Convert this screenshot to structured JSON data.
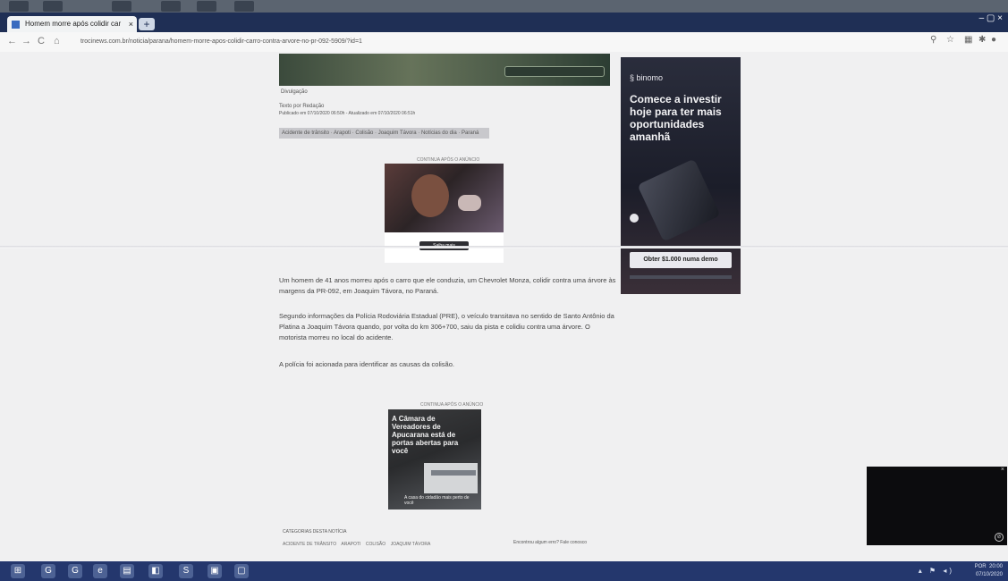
{
  "browser": {
    "tab_title": "Homem morre após colidir car",
    "tab_close": "×",
    "new_tab": "+",
    "window_controls": "– ▢ ×",
    "url": "trocinews.com.br/noticia/parana/homem-morre-apos-colidir-carro-contra-arvore-no-pr-092-5909/?id=1",
    "nav_back": "←",
    "nav_forward": "→",
    "nav_reload": "C",
    "nav_home": "⌂"
  },
  "article": {
    "hero_caption": "Divulgação",
    "byline_line1": "Texto por Redação",
    "byline_line2": "Publicado em 07/10/2020 06:50h - Atualizado em 07/10/2020 06:51h",
    "tags": "Acidente de trânsito · Arapoti · Colisão · Joaquim Távora · Notícias do dia · Paraná",
    "ad_label_top": "CONTINUA APÓS O ANÚNCIO",
    "video_button": "Saiba mais",
    "paragraph1": "Um homem de 41 anos morreu após o carro que ele conduzia, um Chevrolet Monza, colidir contra uma árvore às margens da PR-092, em Joaquim Távora, no Paraná.",
    "paragraph2": "Segundo informações da Polícia Rodoviária Estadual (PRE), o veículo transitava no sentido de Santo Antônio da Platina a Joaquim Távora quando, por volta do km 306+700, saiu da pista e colidiu contra uma árvore. O motorista morreu no local do acidente.",
    "paragraph3": "A polícia foi acionada para identificar as causas da colisão.",
    "ad_label_bottom": "CONTINUA APÓS O ANÚNCIO",
    "footer_label": "CATEGORIAS DESTA NOTÍCIA",
    "footer_tags": [
      "ACIDENTE DE TRÂNSITO",
      "ARAPOTI",
      "COLISÃO",
      "JOAQUIM TÁVORA"
    ],
    "footer_share": "Encontrou algum erro? Fale conosco"
  },
  "side_ad": {
    "brand": "§ binomo",
    "headline": "Comece a investir hoje para ter mais oportunidades amanhã",
    "cta": "Obter $1.000 numa demo"
  },
  "promo_ad": {
    "headline": "A Câmara de Vereadores de Apucarana está de portas abertas para você",
    "footer": "A casa do cidadão mais perto de você"
  },
  "taskbar": {
    "time": "20:00",
    "date": "07/10/2020",
    "lang": "POR"
  }
}
